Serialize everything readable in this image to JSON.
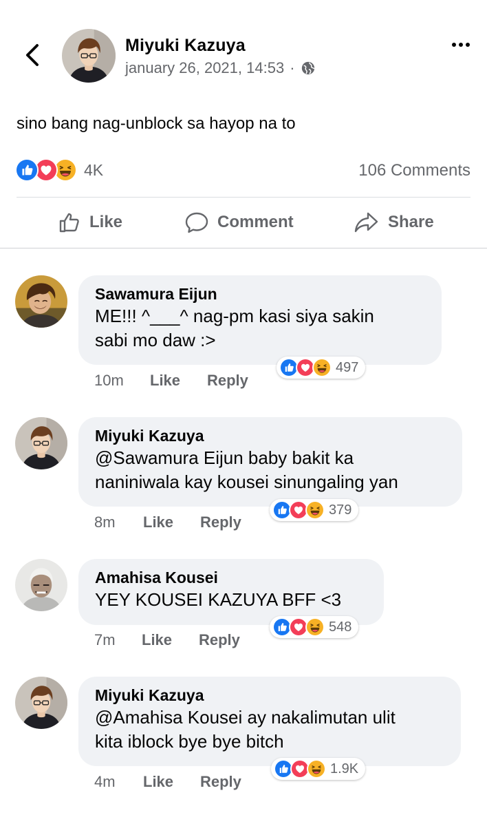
{
  "post": {
    "author": "Miyuki Kazuya",
    "timestamp": "january 26, 2021, 14:53",
    "separator": "·",
    "privacy_icon": "globe-icon",
    "text": "sino bang nag-unblock sa hayop na to",
    "reaction_count": "4K",
    "comments_count": "106 Comments"
  },
  "actions": {
    "like": "Like",
    "comment": "Comment",
    "share": "Share"
  },
  "comments": [
    {
      "name": "Sawamura Eijun",
      "lines": [
        "ME!!! ^___^ nag-pm kasi siya sakin",
        "sabi mo daw :>"
      ],
      "time": "10m",
      "like": "Like",
      "reply": "Reply",
      "reactions": "497"
    },
    {
      "name": "Miyuki Kazuya",
      "lines": [
        "@Sawamura Eijun baby bakit ka",
        "naniniwala kay kousei sinungaling yan"
      ],
      "time": "8m",
      "like": "Like",
      "reply": "Reply",
      "reactions": "379"
    },
    {
      "name": "Amahisa Kousei",
      "lines": [
        "YEY KOUSEI KAZUYA BFF <3"
      ],
      "time": "7m",
      "like": "Like",
      "reply": "Reply",
      "reactions": "548"
    },
    {
      "name": "Miyuki Kazuya",
      "lines": [
        "@Amahisa Kousei ay nakalimutan ulit",
        "kita iblock bye bye bitch"
      ],
      "time": "4m",
      "like": "Like",
      "reply": "Reply",
      "reactions": "1.9K"
    }
  ],
  "colors": {
    "like_blue": "#1877f2",
    "love_red": "#f33e58",
    "haha_yellow": "#f7b125",
    "secondary_text": "#65676b",
    "bubble_bg": "#f0f2f5"
  }
}
